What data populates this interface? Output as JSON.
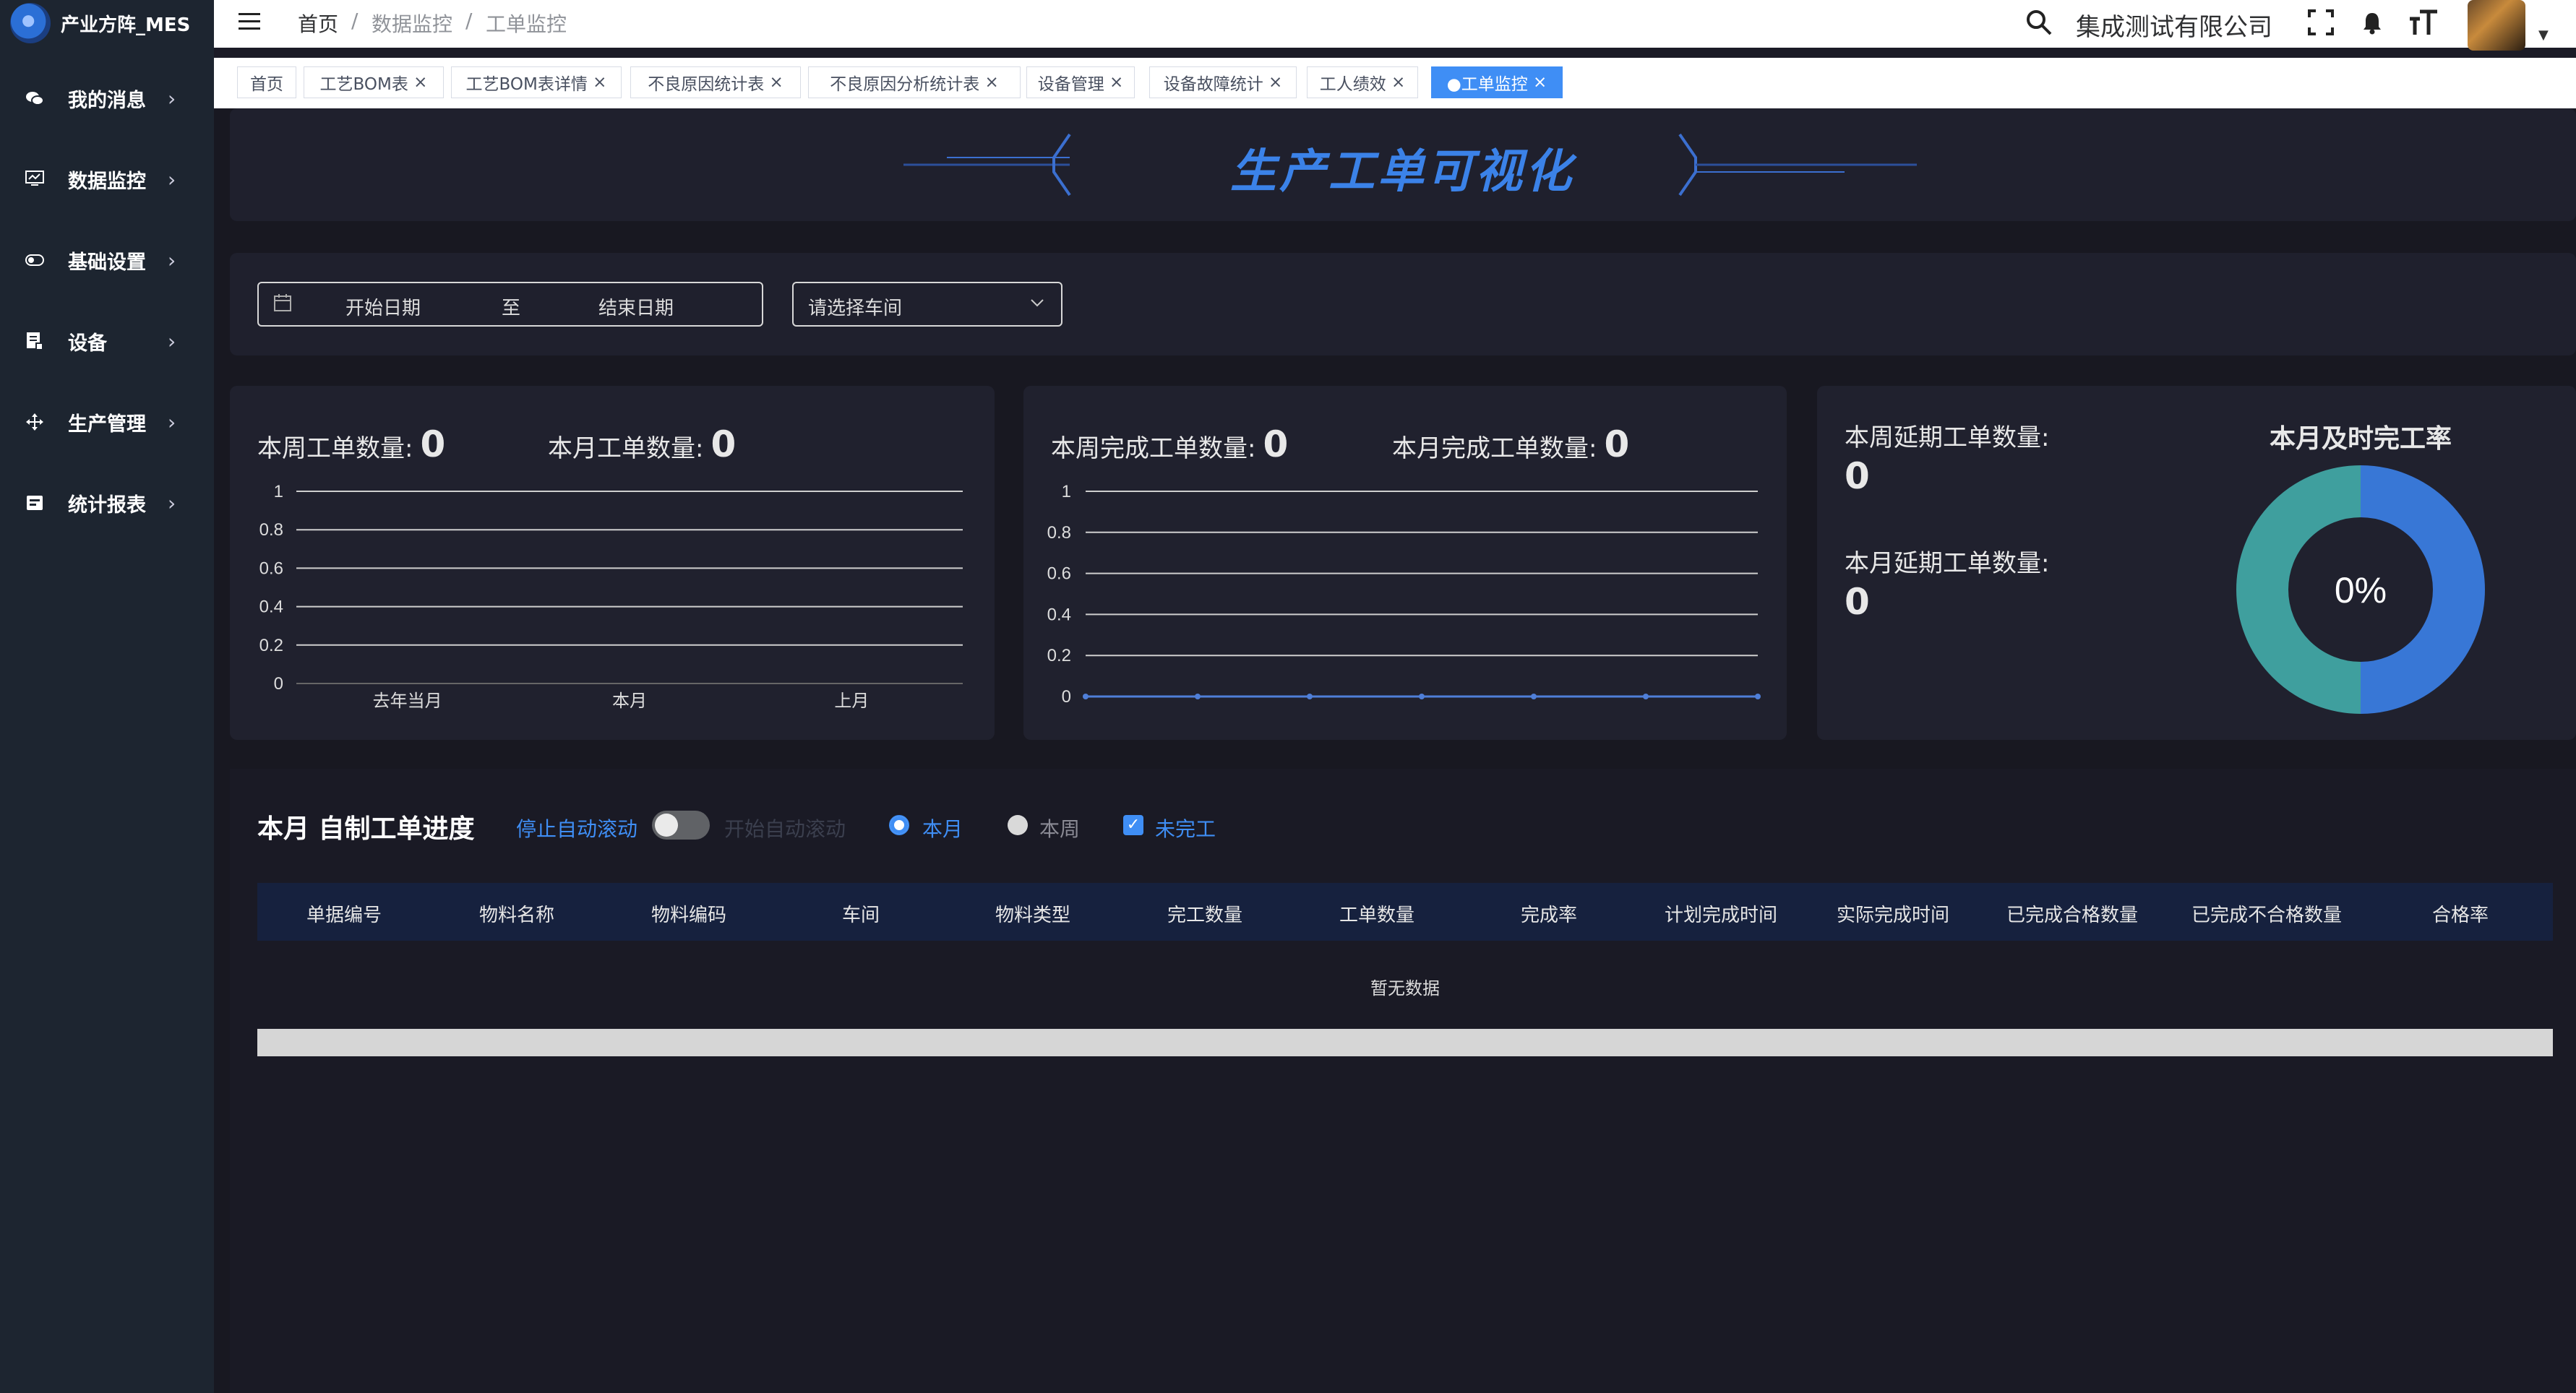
{
  "app": {
    "name": "产业方阵_MES"
  },
  "sidebar": {
    "items": [
      {
        "label": "我的消息",
        "icon": "wechat-icon"
      },
      {
        "label": "数据监控",
        "icon": "monitor-icon"
      },
      {
        "label": "基础设置",
        "icon": "toggle-icon"
      },
      {
        "label": "设备",
        "icon": "device-icon"
      },
      {
        "label": "生产管理",
        "icon": "move-icon"
      },
      {
        "label": "统计报表",
        "icon": "report-icon"
      }
    ]
  },
  "header": {
    "breadcrumb": [
      "首页",
      "数据监控",
      "工单监控"
    ],
    "company": "集成测试有限公司"
  },
  "tabs": [
    {
      "label": "首页",
      "closable": false
    },
    {
      "label": "工艺BOM表",
      "closable": true
    },
    {
      "label": "工艺BOM表详情",
      "closable": true
    },
    {
      "label": "不良原因统计表",
      "closable": true
    },
    {
      "label": "不良原因分析统计表",
      "closable": true
    },
    {
      "label": "设备管理",
      "closable": true
    },
    {
      "label": "设备故障统计",
      "closable": true
    },
    {
      "label": "工人绩效",
      "closable": true
    },
    {
      "label": "●工单监控",
      "closable": true,
      "active": true
    }
  ],
  "banner": {
    "title": "生产工单可视化"
  },
  "filters": {
    "start_date_placeholder": "开始日期",
    "range_separator": "至",
    "end_date_placeholder": "结束日期",
    "workshop_placeholder": "请选择车间"
  },
  "stats": {
    "week_orders_label": "本周工单数量:",
    "week_orders_value": "0",
    "month_orders_label": "本月工单数量:",
    "month_orders_value": "0",
    "week_done_label": "本周完成工单数量:",
    "week_done_value": "0",
    "month_done_label": "本月完成工单数量:",
    "month_done_value": "0",
    "week_delay_label": "本周延期工单数量:",
    "week_delay_value": "0",
    "month_delay_label": "本月延期工单数量:",
    "month_delay_value": "0",
    "ontime_title": "本月及时完工率",
    "ontime_value": "0%"
  },
  "progress": {
    "title": "本月 自制工单进度",
    "stop_scroll": "停止自动滚动",
    "start_scroll": "开始自动滚动",
    "radio_month": "本月",
    "radio_week": "本周",
    "check_unfinished": "未完工",
    "columns": [
      "单据编号",
      "物料名称",
      "物料编码",
      "车间",
      "物料类型",
      "完工数量",
      "工单数量",
      "完成率",
      "计划完成时间",
      "实际完成时间",
      "已完成合格数量",
      "已完成不合格数量",
      "合格率"
    ],
    "empty_text": "暂无数据"
  },
  "chart_data": [
    {
      "type": "bar",
      "categories": [
        "去年当月",
        "本月",
        "上月"
      ],
      "values": [
        0,
        0,
        0
      ],
      "ylim": [
        0,
        1
      ],
      "yticks": [
        "1",
        "0.8",
        "0.6",
        "0.4",
        "0.2",
        "0"
      ],
      "grid": true
    },
    {
      "type": "line",
      "x": [
        1,
        2,
        3,
        4,
        5,
        6,
        7
      ],
      "values": [
        0,
        0,
        0,
        0,
        0,
        0,
        0
      ],
      "ylim": [
        0,
        1
      ],
      "yticks": [
        "1",
        "0.8",
        "0.6",
        "0.4",
        "0.2",
        "0"
      ],
      "grid": true,
      "color": "#4f7fd8"
    },
    {
      "type": "pie",
      "title": "本月及时完工率",
      "center_label": "0%",
      "slices": [
        {
          "value": 50,
          "color": "#3877d6"
        },
        {
          "value": 50,
          "color": "#3f9f9e"
        }
      ]
    }
  ],
  "colors": {
    "accent": "#3f8ef5",
    "title_blue": "#3b82e8",
    "sidebar_bg": "#1d2530",
    "page_bg": "#181821",
    "card_bg": "#20212e",
    "table_head_bg": "#16213e"
  }
}
